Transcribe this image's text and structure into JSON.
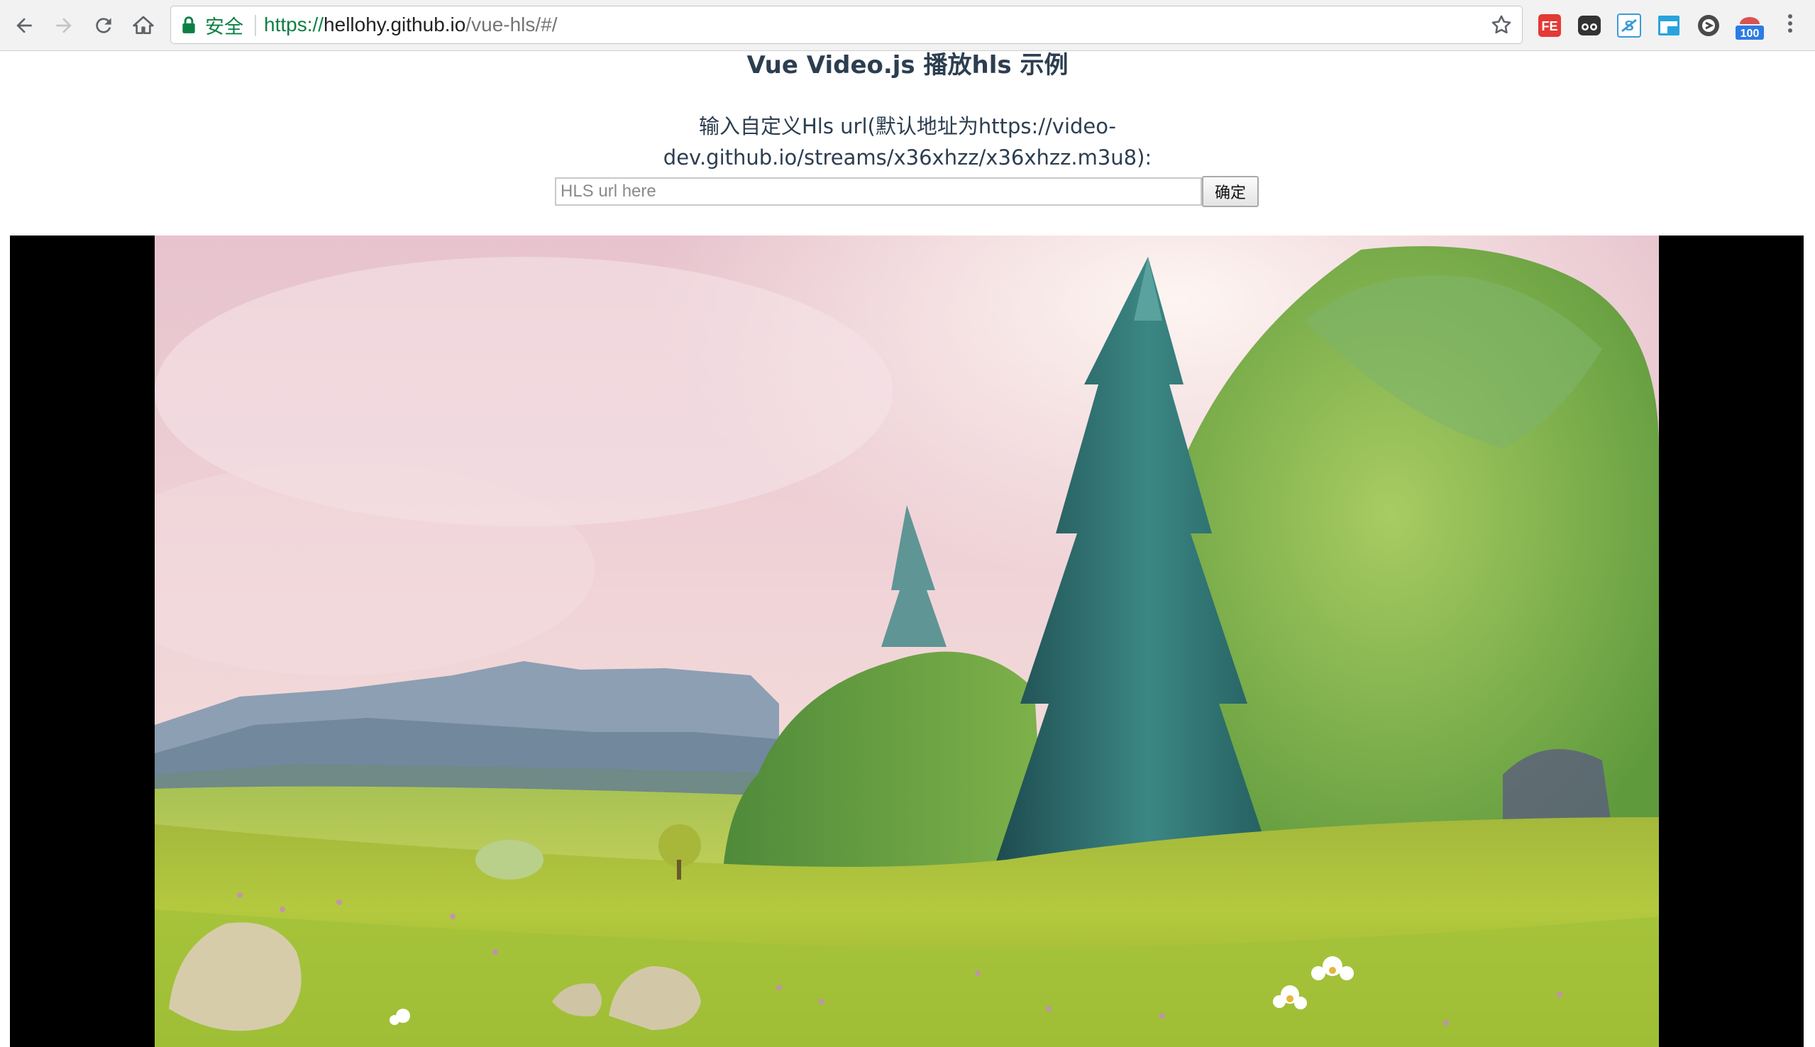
{
  "browser": {
    "security_label": "安全",
    "url": {
      "scheme": "https://",
      "host": "hellohy.github.io",
      "path": "/vue-hls/#/"
    },
    "toolbar_icons": [
      "back-arrow-icon",
      "forward-arrow-icon",
      "reload-icon",
      "home-icon",
      "lock-icon",
      "bookmark-star-icon",
      "more-menu-icon"
    ],
    "extensions": [
      {
        "name": "fe-helper",
        "label": "FE",
        "color": "#e53935"
      },
      {
        "name": "incognito",
        "label": "",
        "color": "#333333"
      },
      {
        "name": "s-extension",
        "label": "S",
        "color": "#3a9bd9"
      },
      {
        "name": "window-extension",
        "label": "",
        "color": "#29a3dd"
      },
      {
        "name": "tampermonkey-like",
        "label": "",
        "color": "#4a4a4a"
      },
      {
        "name": "counter-extension",
        "label": "100",
        "color": "#2c7be5"
      }
    ]
  },
  "page": {
    "title": "Vue Video.js 播放hls 示例",
    "instruction": "输入自定义Hls url(默认地址为https://video-dev.github.io/streams/x36xhzz/x36xhzz.m3u8):",
    "input": {
      "placeholder": "HLS url here",
      "value": ""
    },
    "confirm_label": "确定"
  },
  "video": {
    "scene": "animated-meadow-with-trees"
  }
}
